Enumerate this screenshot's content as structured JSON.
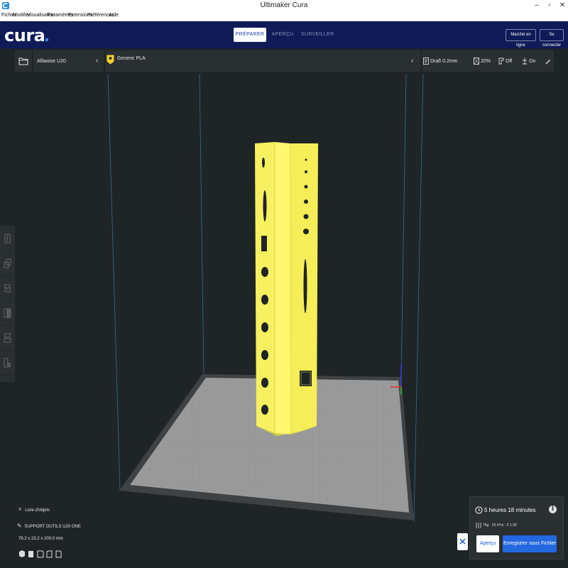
{
  "window": {
    "title": "Ultimaker Cura",
    "controls": {
      "minimize": "–",
      "maximize": "▫",
      "close": "✕"
    }
  },
  "menu": {
    "items": [
      "Fichier",
      "Modifier",
      "Visualisation",
      "Paramètres",
      "Extensions",
      "Préférences",
      "Aide"
    ]
  },
  "header": {
    "logo": "cura",
    "tabs": [
      {
        "label": "PRÉPARER",
        "active": true
      },
      {
        "label": "APERÇU",
        "active": false
      },
      {
        "label": "SURVEILLER",
        "active": false
      }
    ],
    "marketplace_label": "Marché en ligne",
    "signin_label": "Se connecter"
  },
  "toolbar": {
    "printer": "Alfawise U20",
    "material": "Generic PLA",
    "profile": "Draft 0.2mm",
    "infill": "20%",
    "support": "Off",
    "adhesion": "On"
  },
  "object": {
    "list_label": "Liste d'objets",
    "name": "SUPPORT OUTILS U20 ONE",
    "dimensions": "76.2 x 23.2 x 200.0 mm"
  },
  "print": {
    "time": "5 heures 18 minutes",
    "material": "76g · 25.47m · € 1.90",
    "preview_label": "Aperçu",
    "save_label": "Enregistrer sous Fichier"
  },
  "colors": {
    "header": "#0f1a57",
    "accent": "#2468e0",
    "model": "#f7f060",
    "bed": "#9a9a9a"
  }
}
